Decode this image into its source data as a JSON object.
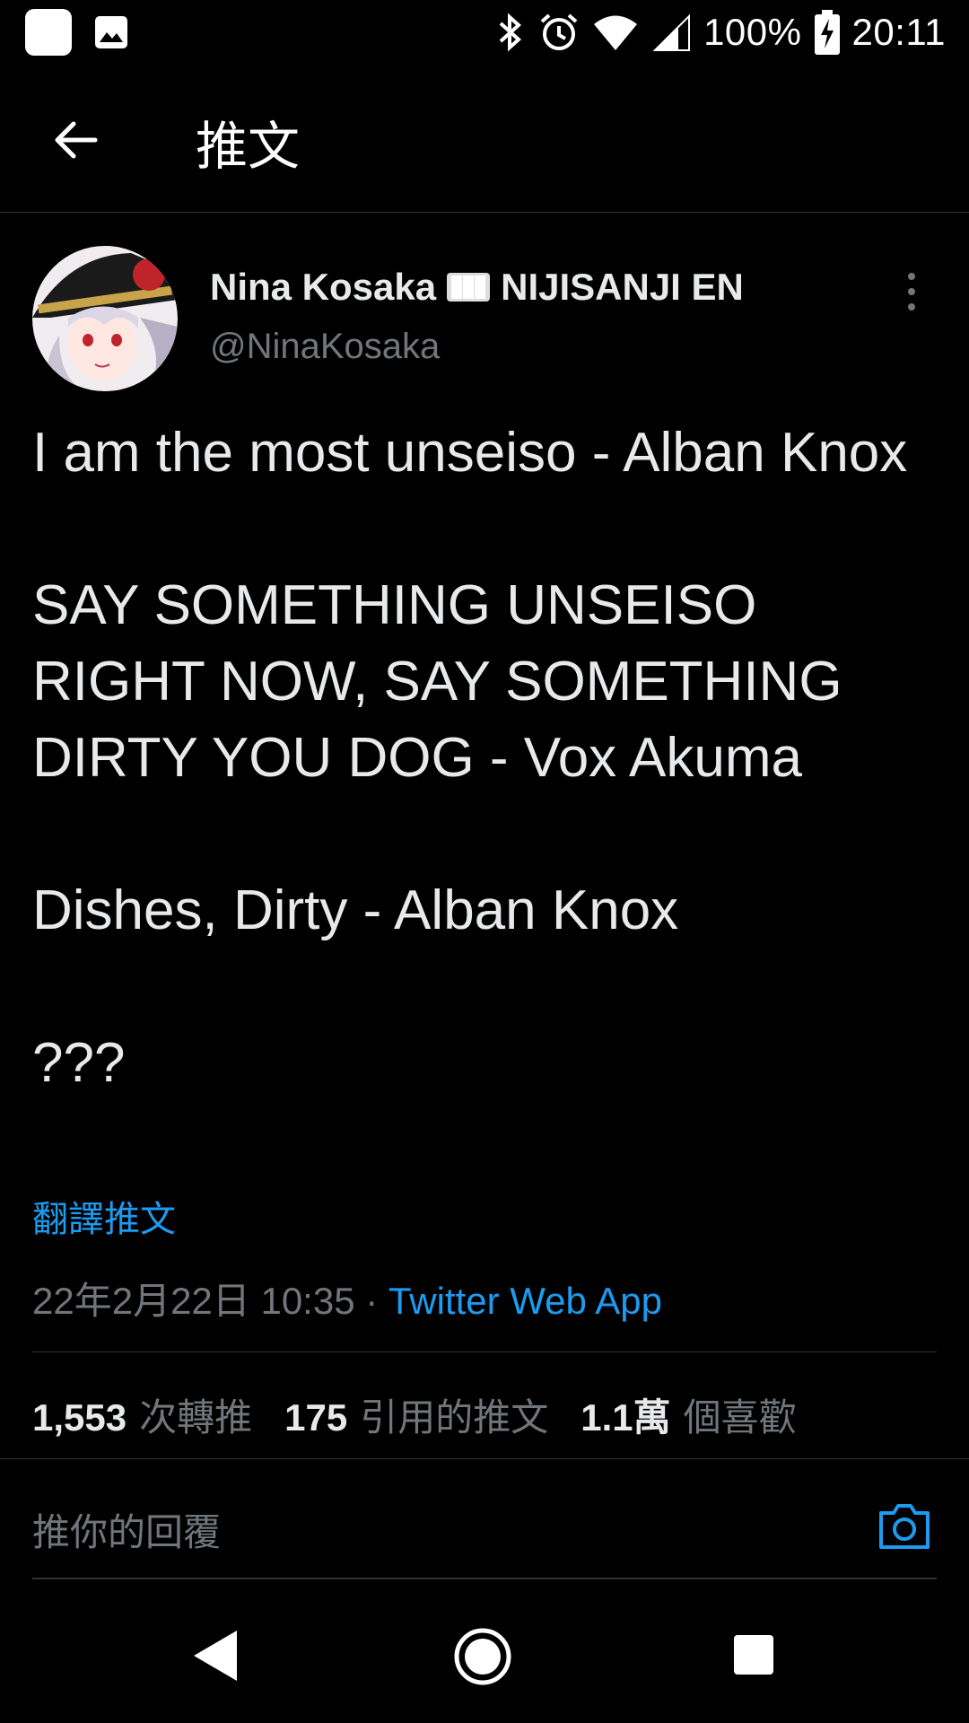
{
  "status_bar": {
    "battery": "100%",
    "time": "20:11"
  },
  "header": {
    "title": "推文"
  },
  "tweet": {
    "author_name_a": "Nina Kosaka",
    "author_name_b": "NIJISANJI EN",
    "handle": "@NinaKosaka",
    "text": "I am the most unseiso - Alban Knox\n\nSAY SOMETHING UNSEISO RIGHT NOW, SAY SOMETHING DIRTY YOU DOG - Vox Akuma\n\nDishes, Dirty - Alban Knox\n\n???",
    "translate_label": "翻譯推文",
    "timestamp": "22年2月22日 10:35",
    "separator": " · ",
    "source": "Twitter Web App"
  },
  "stats": {
    "retweets_count": "1,553",
    "retweets_label": "次轉推",
    "quotes_count": "175",
    "quotes_label": "引用的推文",
    "likes_count": "1.1萬",
    "likes_label": "個喜歡"
  },
  "reply": {
    "placeholder": "推你的回覆"
  },
  "icons": [
    "app-icon",
    "image-notification-icon",
    "bluetooth-icon",
    "alarm-icon",
    "wifi-icon",
    "signal-icon",
    "battery-charging-icon",
    "back-arrow-icon",
    "more-vertical-icon",
    "slot-machine-emoji",
    "camera-icon",
    "nav-back-icon",
    "nav-home-icon",
    "nav-recents-icon"
  ],
  "colors": {
    "background": "#000000",
    "accent": "#1d9bf0",
    "muted": "#71767b",
    "text": "#e7e9ea"
  }
}
